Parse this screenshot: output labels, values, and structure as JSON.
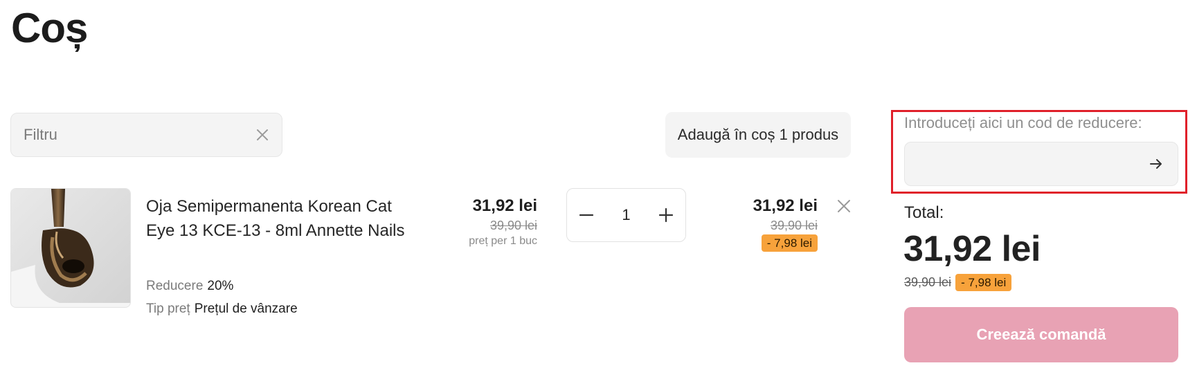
{
  "page": {
    "title": "Coș"
  },
  "filter": {
    "placeholder": "Filtru",
    "value": ""
  },
  "toolbar": {
    "add_to_cart_label": "Adaugă în coș 1 produs"
  },
  "cart_item": {
    "name": "Oja Semipermanenta Korean Cat Eye 13 KCE-13 - 8ml Annette Nails",
    "discount_label": "Reducere",
    "discount_value": "20%",
    "price_type_label": "Tip preț",
    "price_type_value": "Prețul de vânzare",
    "unit_price": "31,92 lei",
    "unit_old_price": "39,90 lei",
    "unit_note": "preț per 1 buc",
    "quantity": "1",
    "line_total": "31,92 lei",
    "line_old_total": "39,90 lei",
    "line_discount": "- 7,98 lei"
  },
  "coupon": {
    "label": "Introduceți aici un cod de reducere:",
    "value": ""
  },
  "summary": {
    "total_label": "Total:",
    "total": "31,92 lei",
    "old_total": "39,90 lei",
    "discount": "- 7,98 lei",
    "order_button": "Creează comandă"
  },
  "icons": [
    "clear-icon",
    "minus-icon",
    "plus-icon",
    "close-icon",
    "arrow-right-icon"
  ],
  "colors": {
    "badge": "#f7a23b",
    "order_button": "#e8a2b4",
    "highlight_border": "#e0202a",
    "field_bg": "#f4f4f4"
  }
}
